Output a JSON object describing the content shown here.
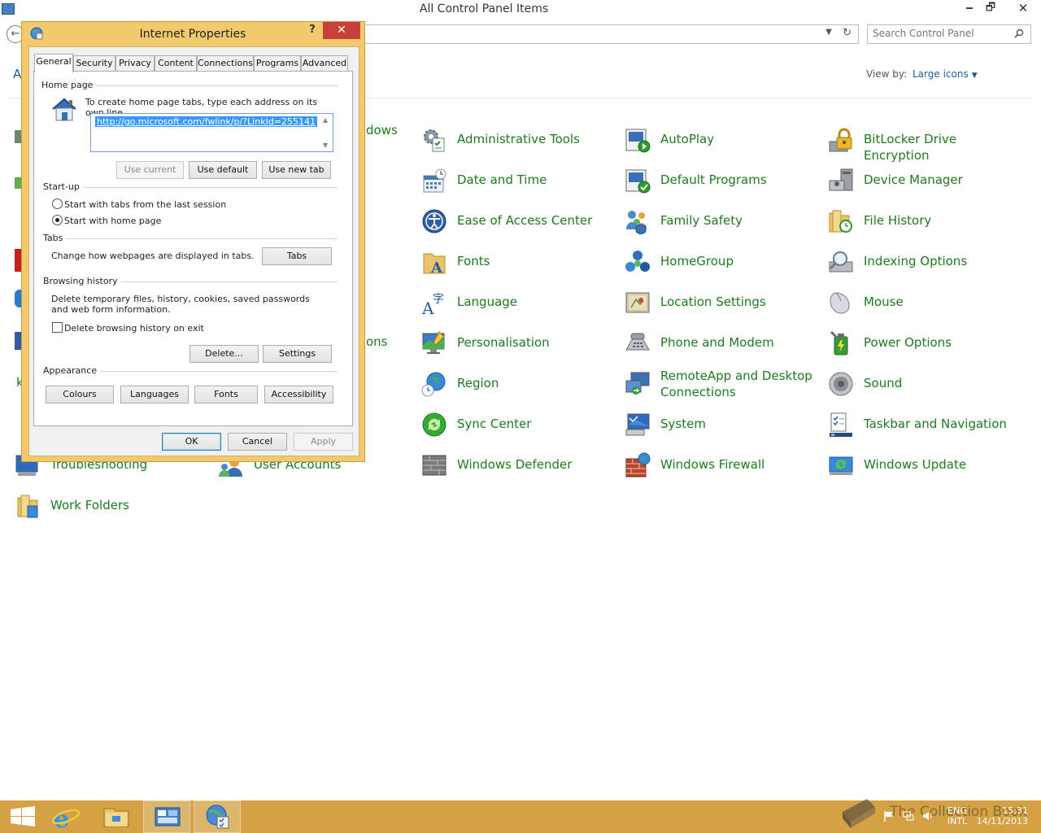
{
  "window": {
    "title": "All Control Panel Items",
    "minimize": "🗕",
    "maximize": "🗗",
    "close": "✕"
  },
  "nav": {
    "back": "←",
    "refresh": "↻",
    "dropdown": "▼",
    "search_placeholder": "Search Control Panel"
  },
  "header": {
    "adjust_fragment": "A",
    "view_by_label": "View by:",
    "view_by_value": "Large icons",
    "view_by_arrow": "▼"
  },
  "fragments": {
    "windows_fragment": "dows",
    "options_fragment": "ons",
    "k_fragment": "k"
  },
  "items": [
    {
      "label": "Administrative Tools",
      "icon": "admin-tools-icon"
    },
    {
      "label": "AutoPlay",
      "icon": "autoplay-icon"
    },
    {
      "label": "BitLocker Drive Encryption",
      "icon": "bitlocker-icon"
    },
    {
      "label": "Date and Time",
      "icon": "date-time-icon"
    },
    {
      "label": "Default Programs",
      "icon": "default-programs-icon"
    },
    {
      "label": "Device Manager",
      "icon": "device-manager-icon"
    },
    {
      "label": "Ease of Access Center",
      "icon": "ease-of-access-icon"
    },
    {
      "label": "Family Safety",
      "icon": "family-safety-icon"
    },
    {
      "label": "File History",
      "icon": "file-history-icon"
    },
    {
      "label": "Fonts",
      "icon": "fonts-icon"
    },
    {
      "label": "HomeGroup",
      "icon": "homegroup-icon"
    },
    {
      "label": "Indexing Options",
      "icon": "indexing-icon"
    },
    {
      "label": "Language",
      "icon": "language-icon"
    },
    {
      "label": "Location Settings",
      "icon": "location-icon"
    },
    {
      "label": "Mouse",
      "icon": "mouse-icon"
    },
    {
      "label": "Personalisation",
      "icon": "personalisation-icon"
    },
    {
      "label": "Phone and Modem",
      "icon": "phone-modem-icon"
    },
    {
      "label": "Power Options",
      "icon": "power-icon"
    },
    {
      "label": "Region",
      "icon": "region-icon"
    },
    {
      "label": "RemoteApp and Desktop Connections",
      "icon": "remoteapp-icon"
    },
    {
      "label": "Sound",
      "icon": "sound-icon"
    },
    {
      "label": "Sync Center",
      "icon": "sync-icon"
    },
    {
      "label": "System",
      "icon": "system-icon"
    },
    {
      "label": "Taskbar and Navigation",
      "icon": "taskbar-nav-icon"
    },
    {
      "label": "Troubleshooting",
      "icon": "troubleshooting-icon"
    },
    {
      "label": "User Accounts",
      "icon": "user-accounts-icon"
    },
    {
      "label": "Windows Defender",
      "icon": "defender-icon"
    },
    {
      "label": "Windows Firewall",
      "icon": "firewall-icon"
    },
    {
      "label": "Windows Update",
      "icon": "windows-update-icon"
    },
    {
      "label": "Work Folders",
      "icon": "work-folders-icon"
    }
  ],
  "dialog": {
    "title": "Internet Properties",
    "help": "?",
    "close": "✕",
    "tabs": [
      "General",
      "Security",
      "Privacy",
      "Content",
      "Connections",
      "Programs",
      "Advanced"
    ],
    "active_tab": "General",
    "home_page": {
      "title": "Home page",
      "instruction": "To create home page tabs, type each address on its own line.",
      "url": "http://go.microsoft.com/fwlink/p/?LinkId=255141",
      "use_current": "Use current",
      "use_default": "Use default",
      "use_new_tab": "Use new tab"
    },
    "startup": {
      "title": "Start-up",
      "option_last_session": "Start with tabs from the last session",
      "option_home_page": "Start with home page",
      "selected": "Start with home page"
    },
    "tabs_group": {
      "title": "Tabs",
      "description": "Change how webpages are displayed in tabs.",
      "button": "Tabs"
    },
    "browsing_history": {
      "title": "Browsing history",
      "description": "Delete temporary files, history, cookies, saved passwords and web form information.",
      "delete_on_exit": "Delete browsing history on exit",
      "delete_on_exit_checked": false,
      "delete_button": "Delete...",
      "settings_button": "Settings"
    },
    "appearance": {
      "title": "Appearance",
      "colours": "Colours",
      "languages": "Languages",
      "fonts": "Fonts",
      "accessibility": "Accessibility"
    },
    "footer": {
      "ok": "OK",
      "cancel": "Cancel",
      "apply": "Apply"
    }
  },
  "taskbar": {
    "watermark": "The Collection Book",
    "language": "ENG",
    "layout": "INTL",
    "time": "15:31",
    "date": "14/11/2013"
  },
  "colors": {
    "link_green": "#1d7a1d",
    "accent_blue": "#1e5a9e",
    "dialog_frame": "#f2ca6e",
    "taskbar": "#d4a244",
    "close_red": "#c7403a"
  }
}
